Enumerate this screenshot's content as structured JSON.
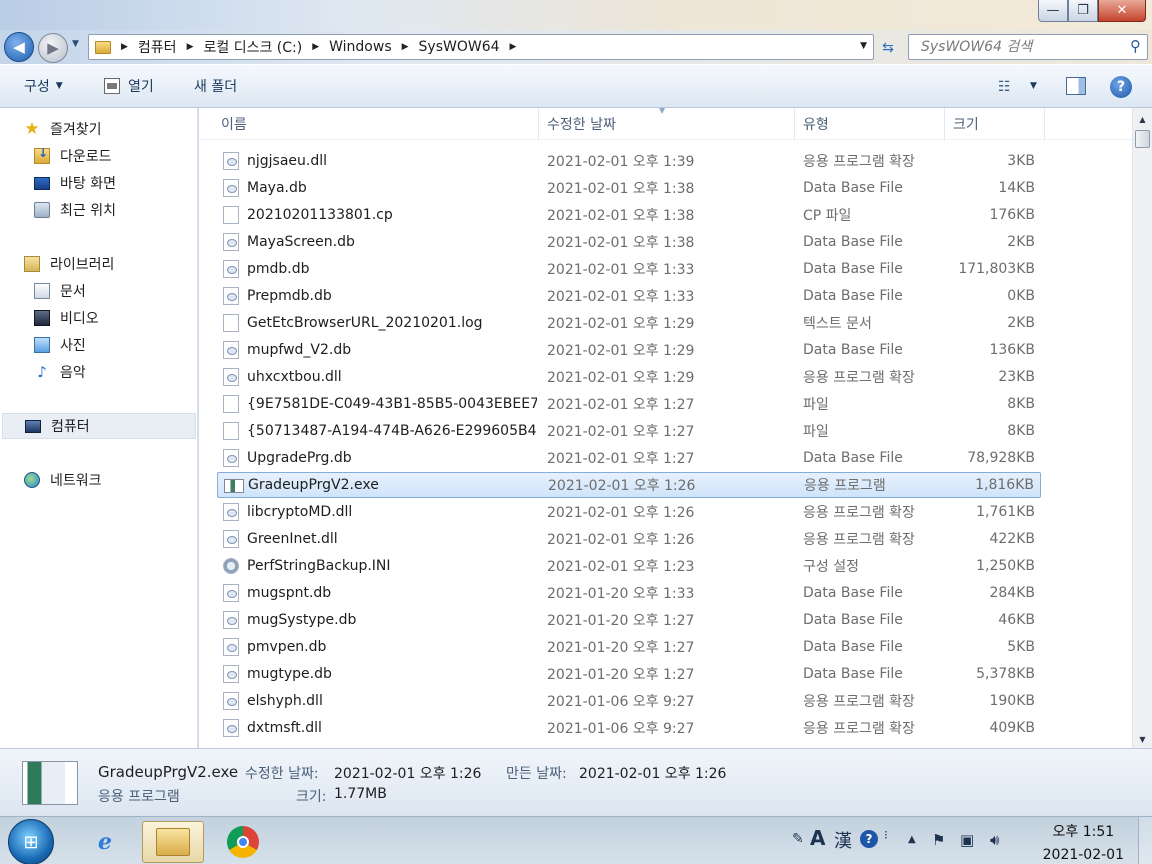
{
  "window": {
    "minimize_glyph": "—",
    "maximize_glyph": "❐",
    "close_glyph": "✕"
  },
  "address": {
    "back_glyph": "◀",
    "forward_glyph": "▶",
    "crumbs": [
      "컴퓨터",
      "로컬 디스크 (C:)",
      "Windows",
      "SysWOW64"
    ],
    "search_placeholder": "SysWOW64 검색"
  },
  "toolbar": {
    "organize_label": "구성",
    "open_label": "열기",
    "new_folder_label": "새 폴더"
  },
  "nav": {
    "favorites": "즐겨찾기",
    "downloads": "다운로드",
    "desktop": "바탕 화면",
    "recent": "최근 위치",
    "libraries": "라이브러리",
    "documents": "문서",
    "videos": "비디오",
    "pictures": "사진",
    "music": "음악",
    "computer": "컴퓨터",
    "network": "네트워크"
  },
  "columns": {
    "name": "이름",
    "date": "수정한 날짜",
    "type": "유형",
    "size": "크기"
  },
  "files": [
    {
      "name": "njgjsaeu.dll",
      "date": "2021-02-01 오후 1:39",
      "type": "응용 프로그램 확장",
      "size": "3KB",
      "icon": "dll"
    },
    {
      "name": "Maya.db",
      "date": "2021-02-01 오후 1:38",
      "type": "Data Base File",
      "size": "14KB",
      "icon": "db"
    },
    {
      "name": "20210201133801.cp",
      "date": "2021-02-01 오후 1:38",
      "type": "CP 파일",
      "size": "176KB",
      "icon": "file"
    },
    {
      "name": "MayaScreen.db",
      "date": "2021-02-01 오후 1:38",
      "type": "Data Base File",
      "size": "2KB",
      "icon": "db"
    },
    {
      "name": "pmdb.db",
      "date": "2021-02-01 오후 1:33",
      "type": "Data Base File",
      "size": "171,803KB",
      "icon": "db"
    },
    {
      "name": "Prepmdb.db",
      "date": "2021-02-01 오후 1:33",
      "type": "Data Base File",
      "size": "0KB",
      "icon": "db"
    },
    {
      "name": "GetEtcBrowserURL_20210201.log",
      "date": "2021-02-01 오후 1:29",
      "type": "텍스트 문서",
      "size": "2KB",
      "icon": "file"
    },
    {
      "name": "mupfwd_V2.db",
      "date": "2021-02-01 오후 1:29",
      "type": "Data Base File",
      "size": "136KB",
      "icon": "db"
    },
    {
      "name": "uhxcxtbou.dll",
      "date": "2021-02-01 오후 1:29",
      "type": "응용 프로그램 확장",
      "size": "23KB",
      "icon": "dll"
    },
    {
      "name": "{9E7581DE-C049-43B1-85B5-0043EBEE7...",
      "date": "2021-02-01 오후 1:27",
      "type": "파일",
      "size": "8KB",
      "icon": "file"
    },
    {
      "name": "{50713487-A194-474B-A626-E299605B4...",
      "date": "2021-02-01 오후 1:27",
      "type": "파일",
      "size": "8KB",
      "icon": "file"
    },
    {
      "name": "UpgradePrg.db",
      "date": "2021-02-01 오후 1:27",
      "type": "Data Base File",
      "size": "78,928KB",
      "icon": "db"
    },
    {
      "name": "GradeupPrgV2.exe",
      "date": "2021-02-01 오후 1:26",
      "type": "응용 프로그램",
      "size": "1,816KB",
      "icon": "exe",
      "selected": true
    },
    {
      "name": "libcryptoMD.dll",
      "date": "2021-02-01 오후 1:26",
      "type": "응용 프로그램 확장",
      "size": "1,761KB",
      "icon": "dll"
    },
    {
      "name": "GreenInet.dll",
      "date": "2021-02-01 오후 1:26",
      "type": "응용 프로그램 확장",
      "size": "422KB",
      "icon": "dll"
    },
    {
      "name": "PerfStringBackup.INI",
      "date": "2021-02-01 오후 1:23",
      "type": "구성 설정",
      "size": "1,250KB",
      "icon": "ini"
    },
    {
      "name": "mugspnt.db",
      "date": "2021-01-20 오후 1:33",
      "type": "Data Base File",
      "size": "284KB",
      "icon": "db"
    },
    {
      "name": "mugSystype.db",
      "date": "2021-01-20 오후 1:27",
      "type": "Data Base File",
      "size": "46KB",
      "icon": "db"
    },
    {
      "name": "pmvpen.db",
      "date": "2021-01-20 오후 1:27",
      "type": "Data Base File",
      "size": "5KB",
      "icon": "db"
    },
    {
      "name": "mugtype.db",
      "date": "2021-01-20 오후 1:27",
      "type": "Data Base File",
      "size": "5,378KB",
      "icon": "db"
    },
    {
      "name": "elshyph.dll",
      "date": "2021-01-06 오후 9:27",
      "type": "응용 프로그램 확장",
      "size": "190KB",
      "icon": "dll"
    },
    {
      "name": "dxtmsft.dll",
      "date": "2021-01-06 오후 9:27",
      "type": "응용 프로그램 확장",
      "size": "409KB",
      "icon": "dll"
    }
  ],
  "details": {
    "name": "GradeupPrgV2.exe",
    "modified_label": "수정한 날짜:",
    "modified_value": "2021-02-01 오후 1:26",
    "created_label": "만든 날짜:",
    "created_value": "2021-02-01 오후 1:26",
    "type": "응용 프로그램",
    "size_label": "크기:",
    "size_value": "1.77MB"
  },
  "taskbar": {
    "ime_mode": "A",
    "ime_hanja": "漢",
    "time": "오후 1:51",
    "date": "2021-02-01"
  }
}
